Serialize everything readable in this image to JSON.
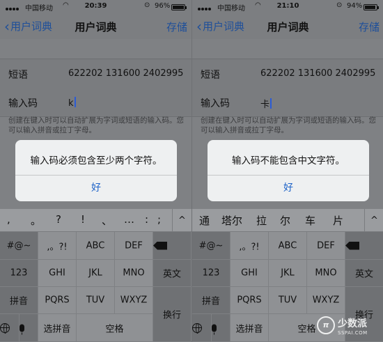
{
  "left": {
    "status": {
      "carrier": "中国移动",
      "time": "20:39",
      "battery": "96%",
      "battery_level": 0.96
    },
    "nav": {
      "back": "用户词典",
      "title": "用户词典",
      "save": "存储"
    },
    "phrase_label": "短语",
    "phrase_value": "622202 131600 2402995",
    "code_label": "输入码",
    "code_value": "k",
    "hint": "创建在键入时可以自动扩展为字词或短语的输入码。您可以输入拼音或拉丁字母。",
    "alert": {
      "message": "输入码必须包含至少两个字符。",
      "button": "好"
    },
    "candidates": [
      ",",
      "。",
      "?",
      "!",
      "、",
      "…",
      ":",
      ";"
    ]
  },
  "right": {
    "status": {
      "carrier": "中国移动",
      "time": "21:10",
      "battery": "94%",
      "battery_level": 0.94
    },
    "nav": {
      "back": "用户词典",
      "title": "用户词典",
      "save": "存储"
    },
    "phrase_label": "短语",
    "phrase_value": "622202 131600 2402995",
    "code_label": "输入码",
    "code_value": "卡",
    "hint": "创建在键入时可以自动扩展为字词或短语的输入码。您可以输入拼音或拉丁字母。",
    "alert": {
      "message": "输入码不能包含中文字符。",
      "button": "好"
    },
    "candidates": [
      "通",
      "塔尔",
      "拉",
      "尔",
      "车",
      "片"
    ]
  },
  "keyboard": {
    "sym": "#@~",
    "punct": ",。?!",
    "abc": "ABC",
    "def": "DEF",
    "ghi": "GHI",
    "jkl": "JKL",
    "mno": "MNO",
    "pqrs": "PQRS",
    "tuv": "TUV",
    "wxyz": "WXYZ",
    "num": "123",
    "pinyin": "拼音",
    "english": "英文",
    "select_pinyin": "选拼音",
    "space": "空格",
    "return": "换行",
    "up_arrow": "^",
    "icons": [
      "delete-icon",
      "globe-icon",
      "mic-icon",
      "chevron-up-icon",
      "back-chevron-icon",
      "wifi-icon",
      "lock-icon",
      "battery-icon"
    ]
  },
  "watermark": {
    "cn": "少数派",
    "en": "SSPAI.COM",
    "logo": "π"
  }
}
